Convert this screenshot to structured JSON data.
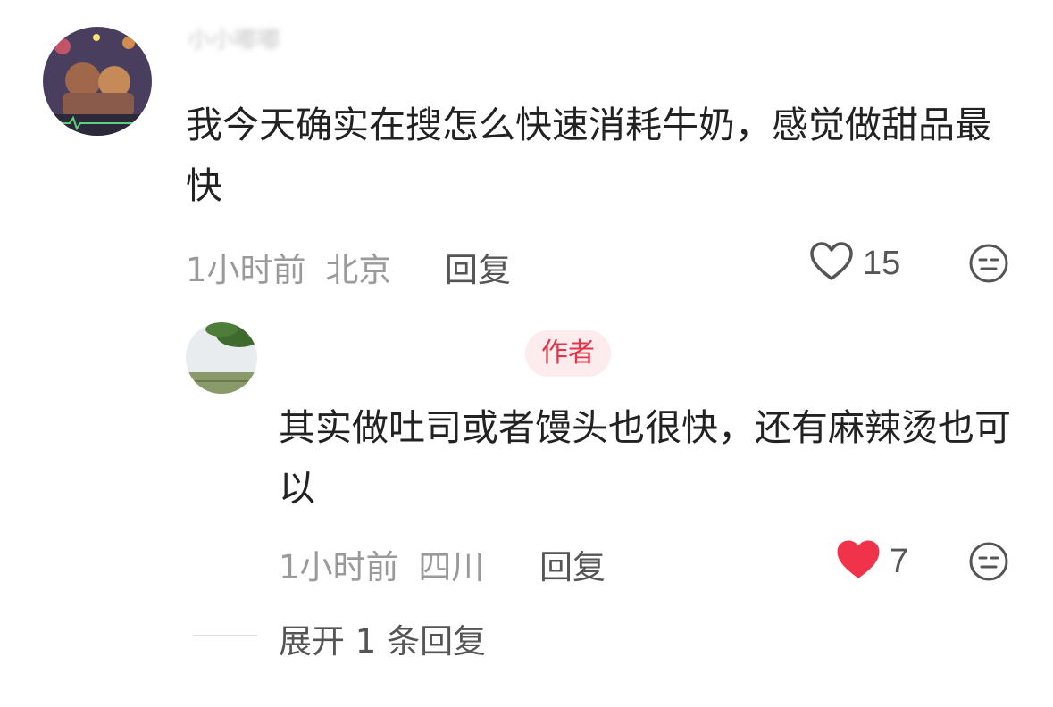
{
  "comments": [
    {
      "username": "小小嘟嘟",
      "text": "我今天确实在搜怎么快速消耗牛奶，感觉做甜品最快",
      "time": "1小时前",
      "location": "北京",
      "reply_label": "回复",
      "likes": "15",
      "liked": false
    },
    {
      "username": "",
      "author_badge": "作者",
      "text": "其实做吐司或者馒头也很快，还有麻辣烫也可以",
      "time": "1小时前",
      "location": "四川",
      "reply_label": "回复",
      "likes": "7",
      "liked": true
    }
  ],
  "expand_replies": "展开 1 条回复",
  "colors": {
    "liked_heart": "#f0324a",
    "author_badge_bg": "#fdecee",
    "author_badge_text": "#e2354a",
    "meta_text": "#9a9a9a"
  },
  "icons": {
    "like": "heart-icon",
    "dislike": "meh-face-icon"
  }
}
